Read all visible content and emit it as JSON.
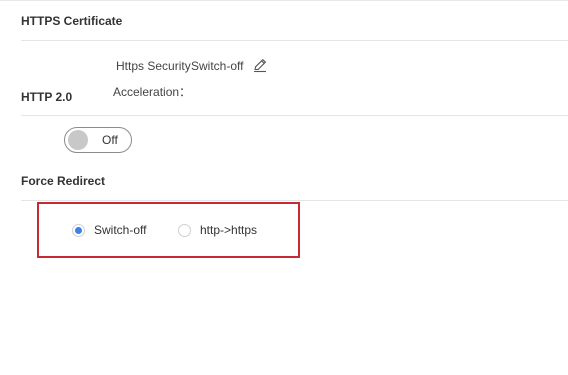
{
  "sections": {
    "https_certificate": {
      "title": "HTTPS Certificate"
    },
    "http2": {
      "title": "HTTP 2.0",
      "field_label_line1": "Https Security",
      "field_value": "Switch-off",
      "field_label_line2": "Acceleration：",
      "toggle_label": "Off",
      "toggle_state": "off"
    },
    "force_redirect": {
      "title": "Force Redirect",
      "options": [
        {
          "label": "Switch-off",
          "selected": true
        },
        {
          "label": "http->https",
          "selected": false
        }
      ]
    }
  },
  "colors": {
    "highlight_border": "#c62a35",
    "radio_selected": "#3b82e6"
  },
  "icons": {
    "edit": "pencil-icon"
  }
}
